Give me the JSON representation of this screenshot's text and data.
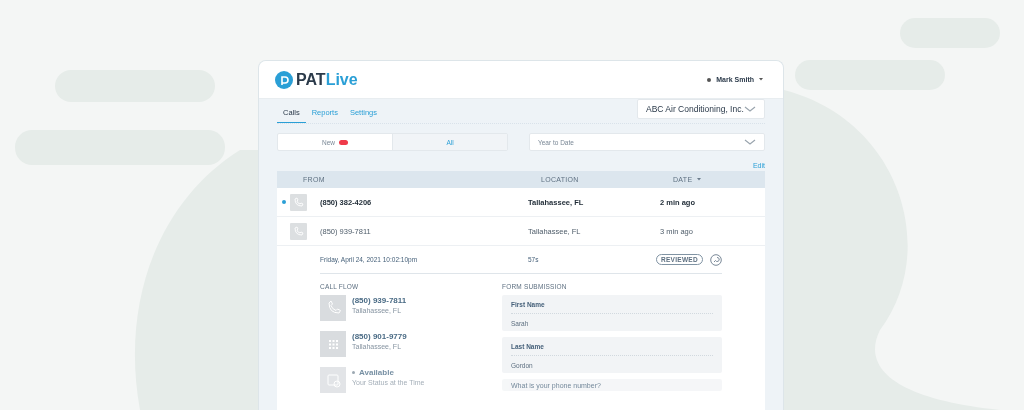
{
  "header": {
    "logo": {
      "prefix": "PAT",
      "suffix": "Live"
    },
    "user": {
      "name": "Mark Smith"
    }
  },
  "tabs": [
    {
      "label": "Calls",
      "selected": true
    },
    {
      "label": "Reports",
      "selected": false
    },
    {
      "label": "Settings",
      "selected": false
    }
  ],
  "account_select": {
    "value": "ABC Air Conditioning, Inc."
  },
  "filter": {
    "segments": [
      {
        "label": "New",
        "selected": false,
        "badge": true
      },
      {
        "label": "All",
        "selected": false,
        "badge": false
      }
    ]
  },
  "period_select": {
    "value": "Year to Date"
  },
  "edit_link": "Edit",
  "table": {
    "columns": [
      {
        "label": "FROM",
        "sorted": false
      },
      {
        "label": "LOCATION",
        "sorted": false
      },
      {
        "label": "DATE",
        "sorted": true
      }
    ],
    "rows": [
      {
        "from": "(850) 382-4206",
        "location": "Tallahassee, FL",
        "date": "2 min ago",
        "unread": true
      },
      {
        "from": "(850) 939-7811",
        "location": "Tallahassee, FL",
        "date": "3 min ago",
        "unread": false
      }
    ]
  },
  "detail": {
    "datetime": "Friday, April 24, 2021  10:02:10pm",
    "duration": "57s",
    "status": "REVIEWED",
    "call_flow": {
      "title": "CALL FLOW",
      "steps": [
        {
          "kind": "phone",
          "title": "(850) 939-7811",
          "subtitle": "Tallahassee, FL"
        },
        {
          "kind": "keypad",
          "title": "(850) 901-9779",
          "subtitle": "Tallahassee, FL"
        },
        {
          "kind": "status",
          "title": "Available",
          "subtitle": "Your Status at the Time"
        }
      ]
    },
    "form": {
      "title": "FORM SUBMISSION",
      "fields": [
        {
          "label": "First Name",
          "value": "Sarah"
        },
        {
          "label": "Last Name",
          "value": "Gordon"
        },
        {
          "label": "What is your phone number?"
        }
      ]
    }
  }
}
